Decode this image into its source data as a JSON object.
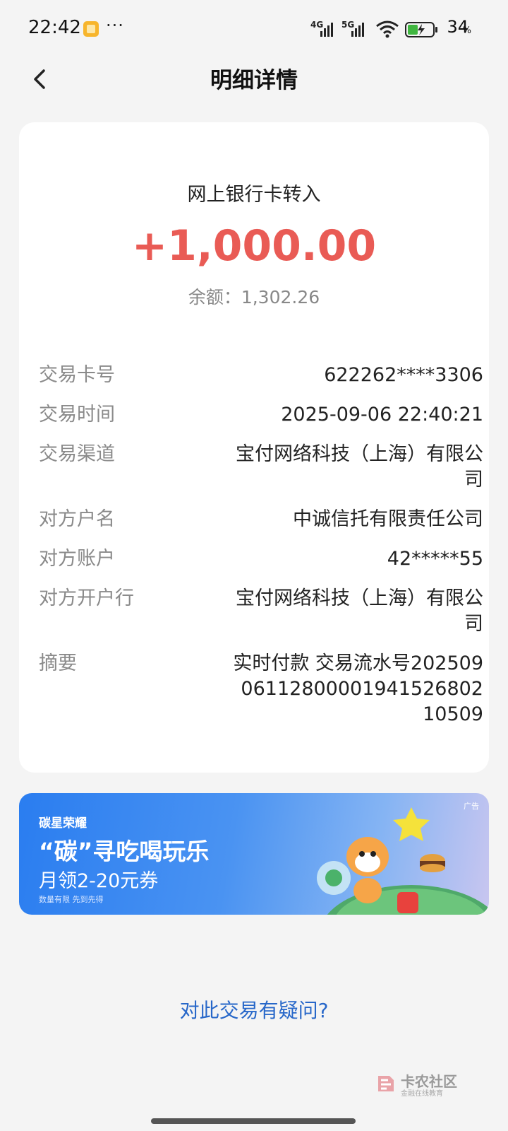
{
  "status_bar": {
    "time": "22:42",
    "dots": "···",
    "network_1": "4G",
    "network_2": "5G",
    "battery_percent": "34",
    "battery_unit": "%"
  },
  "header": {
    "title": "明细详情",
    "back_icon": "chevron-left-icon"
  },
  "transaction": {
    "type": "网上银行卡转入",
    "amount": "+1,000.00",
    "balance": "余额：1,302.26",
    "amount_color": "#e95b55"
  },
  "details": [
    {
      "label": "交易卡号",
      "value": "622262****3306"
    },
    {
      "label": "交易时间",
      "value": "2025-09-06 22:40:21"
    },
    {
      "label": "交易渠道",
      "value": "宝付网络科技（上海）有限公司"
    },
    {
      "label": "对方户名",
      "value": "中诚信托有限责任公司"
    },
    {
      "label": "对方账户",
      "value": "42*****55"
    },
    {
      "label": "对方开户行",
      "value": "宝付网络科技（上海）有限公司"
    },
    {
      "label": "摘要",
      "value": "实时付款 交易流水号2025090611280000194152680210509"
    }
  ],
  "ad": {
    "brand": "碳星荣耀",
    "headline": "“碳”寻吃喝玩乐",
    "subline": "月领2-20元券",
    "note": "数量有限 先到先得",
    "tag": "广告"
  },
  "footer": {
    "question_link": "对此交易有疑问?"
  },
  "watermark": {
    "title": "卡农社区",
    "subtitle": "金融在线教育"
  },
  "colors": {
    "link": "#2767c9",
    "background": "#f4f4f4"
  }
}
